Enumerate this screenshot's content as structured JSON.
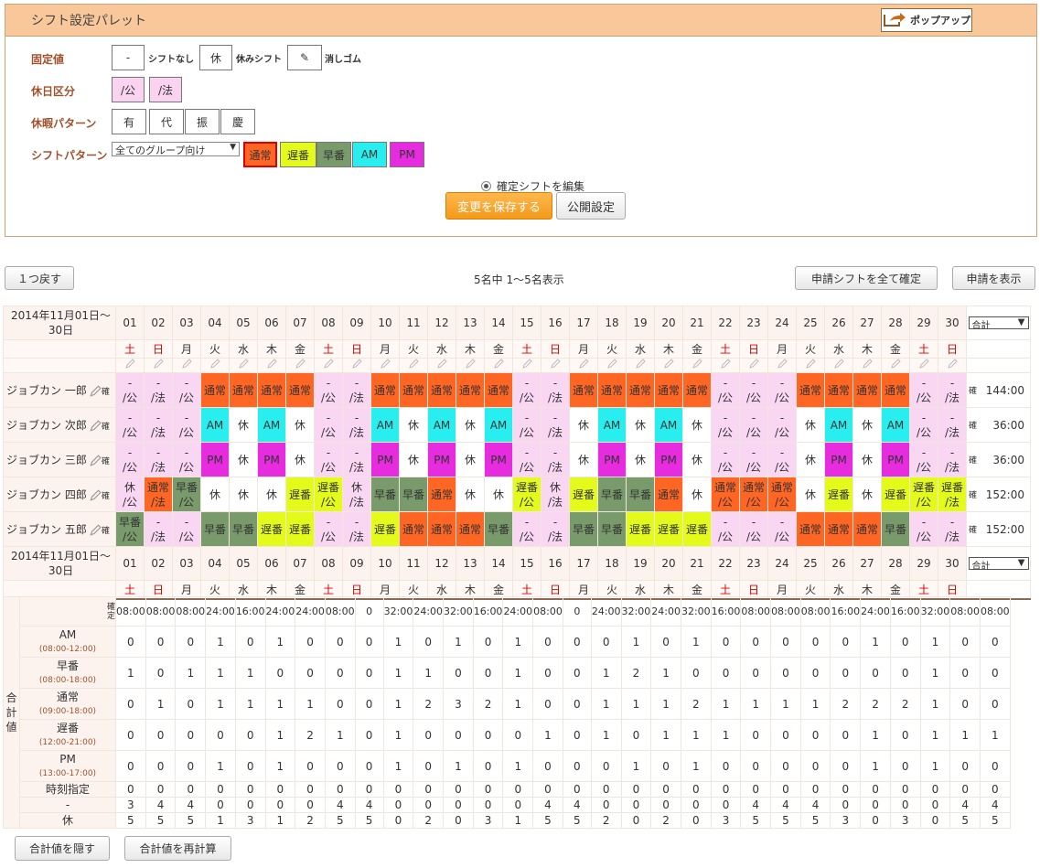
{
  "palette": {
    "title": "シフト設定パレット",
    "popup_label": "ポップアップ",
    "fixed_label": "固定値",
    "fixed": [
      {
        "v": "-",
        "lbl": "シフトなし"
      },
      {
        "v": "休",
        "lbl": "休みシフト"
      },
      {
        "v": "✎",
        "lbl": "消しゴム"
      }
    ],
    "holiday_label": "休日区分",
    "holidays": [
      "/公",
      "/法"
    ],
    "pattern_label": "休暇パターン",
    "patterns": [
      "有",
      "代",
      "振",
      "慶"
    ],
    "shift_label": "シフトパターン",
    "group_select": "全てのグループ向け",
    "shifts": [
      {
        "v": "通常",
        "c": "#ff6523"
      },
      {
        "v": "遅番",
        "c": "#e3fa1a"
      },
      {
        "v": "早番",
        "c": "#799a6b"
      },
      {
        "v": "AM",
        "c": "#29eef0"
      },
      {
        "v": "PM",
        "c": "#e72ce0"
      }
    ],
    "radio_label": "確定シフトを編集",
    "save_label": "変更を保存する",
    "publish_label": "公開設定"
  },
  "toolbar": {
    "undo": "１つ戻す",
    "count": "5名中 1～5名表示",
    "confirm_all": "申請シフトを全て確定",
    "show_req": "申請を表示"
  },
  "period": "2014年11月01日～30日",
  "sum_select": "合計",
  "days": [
    "01",
    "02",
    "03",
    "04",
    "05",
    "06",
    "07",
    "08",
    "09",
    "10",
    "11",
    "12",
    "13",
    "14",
    "15",
    "16",
    "17",
    "18",
    "19",
    "20",
    "21",
    "22",
    "23",
    "24",
    "25",
    "26",
    "27",
    "28",
    "29",
    "30"
  ],
  "dow": [
    "土",
    "日",
    "月",
    "火",
    "水",
    "木",
    "金",
    "土",
    "日",
    "月",
    "火",
    "水",
    "木",
    "金",
    "土",
    "日",
    "月",
    "火",
    "水",
    "木",
    "金",
    "土",
    "日",
    "月",
    "火",
    "水",
    "木",
    "金",
    "土",
    "日"
  ],
  "staff": [
    {
      "name": "ジョブカン 一郎",
      "total": "144:00",
      "cells": [
        "-/公",
        "-/法",
        "-/公",
        "通常",
        "通常",
        "通常",
        "通常",
        "-/公",
        "-/法",
        "通常",
        "通常",
        "通常",
        "通常",
        "通常",
        "-/公",
        "-/法",
        "通常",
        "通常",
        "通常",
        "通常",
        "通常",
        "-/公",
        "-/公",
        "-/公",
        "通常",
        "通常",
        "通常",
        "通常",
        "-/公",
        "-/法"
      ]
    },
    {
      "name": "ジョブカン 次郎",
      "total": "36:00",
      "cells": [
        "-/公",
        "-/法",
        "-/公",
        "AM",
        "休",
        "AM",
        "休",
        "-/公",
        "-/法",
        "AM",
        "休",
        "AM",
        "休",
        "AM",
        "-/公",
        "-/法",
        "休",
        "AM",
        "休",
        "AM",
        "休",
        "-/公",
        "-/公",
        "-/公",
        "休",
        "AM",
        "休",
        "AM",
        "-/公",
        "-/法"
      ]
    },
    {
      "name": "ジョブカン 三郎",
      "total": "36:00",
      "cells": [
        "-/公",
        "-/法",
        "-/公",
        "PM",
        "休",
        "PM",
        "休",
        "-/公",
        "-/法",
        "PM",
        "休",
        "PM",
        "休",
        "PM",
        "-/公",
        "-/法",
        "休",
        "PM",
        "休",
        "PM",
        "休",
        "-/公",
        "-/公",
        "-/公",
        "休",
        "PM",
        "休",
        "PM",
        "-/公",
        "-/法"
      ]
    },
    {
      "name": "ジョブカン 四郎",
      "total": "152:00",
      "cells": [
        "休/公",
        "通常/法",
        "早番/公",
        "休",
        "休",
        "休",
        "遅番",
        "遅番/公",
        "休/法",
        "早番",
        "早番",
        "通常",
        "休",
        "休",
        "遅番/公",
        "休/法",
        "遅番",
        "早番",
        "早番",
        "通常",
        "休",
        "通常/公",
        "通常/公",
        "通常/公",
        "休",
        "遅番",
        "休",
        "遅番",
        "遅番/公",
        "遅番/法"
      ]
    },
    {
      "name": "ジョブカン 五郎",
      "total": "152:00",
      "cells": [
        "早番/公",
        "-/法",
        "-/公",
        "早番",
        "早番",
        "遅番",
        "遅番",
        "-/公",
        "-/法",
        "遅番",
        "通常",
        "通常",
        "通常",
        "早番",
        "-/公",
        "-/法",
        "早番",
        "早番",
        "遅番",
        "遅番",
        "遅番",
        "-/公",
        "-/公",
        "-/公",
        "通常",
        "通常",
        "通常",
        "早番",
        "-/公",
        "-/法"
      ]
    }
  ],
  "totals": {
    "side": "合計値",
    "confirm_mark": "確定",
    "hours": [
      "08:00",
      "08:00",
      "08:00",
      "24:00",
      "16:00",
      "24:00",
      "24:00",
      "08:00",
      "0",
      "32:00",
      "24:00",
      "32:00",
      "16:00",
      "24:00",
      "08:00",
      "0",
      "24:00",
      "32:00",
      "24:00",
      "32:00",
      "16:00",
      "08:00",
      "08:00",
      "08:00",
      "16:00",
      "24:00",
      "16:00",
      "32:00",
      "08:00",
      "08:00"
    ],
    "rows": [
      {
        "name": "AM",
        "time": "(08:00-12:00)",
        "v": [
          0,
          0,
          0,
          1,
          0,
          1,
          0,
          0,
          0,
          1,
          0,
          1,
          0,
          1,
          0,
          0,
          0,
          1,
          0,
          1,
          0,
          0,
          0,
          0,
          0,
          1,
          0,
          1,
          0,
          0
        ]
      },
      {
        "name": "早番",
        "time": "(08:00-18:00)",
        "v": [
          1,
          0,
          1,
          1,
          1,
          0,
          0,
          0,
          0,
          1,
          1,
          0,
          0,
          1,
          0,
          0,
          1,
          2,
          1,
          0,
          0,
          0,
          0,
          0,
          0,
          0,
          0,
          1,
          0,
          0
        ]
      },
      {
        "name": "通常",
        "time": "(09:00-18:00)",
        "v": [
          0,
          1,
          0,
          1,
          1,
          1,
          1,
          0,
          0,
          1,
          2,
          3,
          2,
          1,
          0,
          0,
          1,
          1,
          1,
          2,
          1,
          1,
          1,
          1,
          2,
          2,
          2,
          1,
          0,
          0
        ]
      },
      {
        "name": "遅番",
        "time": "(12:00-21:00)",
        "v": [
          0,
          0,
          0,
          0,
          0,
          1,
          2,
          1,
          0,
          1,
          0,
          0,
          0,
          0,
          1,
          0,
          1,
          0,
          1,
          1,
          1,
          0,
          0,
          0,
          0,
          1,
          0,
          1,
          1,
          1
        ]
      },
      {
        "name": "PM",
        "time": "(13:00-17:00)",
        "v": [
          0,
          0,
          0,
          1,
          0,
          1,
          0,
          0,
          0,
          1,
          0,
          1,
          0,
          1,
          0,
          0,
          0,
          1,
          0,
          1,
          0,
          0,
          0,
          0,
          0,
          1,
          0,
          1,
          0,
          0
        ]
      },
      {
        "name": "時刻指定",
        "time": "",
        "v": [
          0,
          0,
          0,
          0,
          0,
          0,
          0,
          0,
          0,
          0,
          0,
          0,
          0,
          0,
          0,
          0,
          0,
          0,
          0,
          0,
          0,
          0,
          0,
          0,
          0,
          0,
          0,
          0,
          0,
          0
        ]
      },
      {
        "name": "-",
        "time": "",
        "v": [
          3,
          4,
          4,
          0,
          0,
          0,
          0,
          4,
          4,
          0,
          0,
          0,
          0,
          0,
          4,
          4,
          0,
          0,
          0,
          0,
          0,
          4,
          4,
          4,
          0,
          0,
          0,
          0,
          4,
          4
        ]
      },
      {
        "name": "休",
        "time": "",
        "v": [
          5,
          5,
          5,
          1,
          3,
          1,
          2,
          5,
          5,
          0,
          2,
          0,
          3,
          1,
          5,
          5,
          2,
          0,
          2,
          0,
          3,
          5,
          5,
          5,
          3,
          0,
          3,
          0,
          5,
          5
        ]
      }
    ],
    "hide_label": "合計値を隠す",
    "recalc_label": "合計値を再計算"
  }
}
